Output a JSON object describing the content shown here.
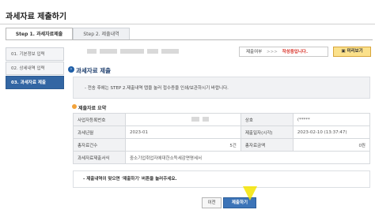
{
  "page": {
    "title": "과세자료 제출하기"
  },
  "tabs": [
    {
      "label": "Step 1. 과세자료제출"
    },
    {
      "label": "Step 2. 제출내역"
    }
  ],
  "steps": [
    {
      "label": "01. 기본정보 입력"
    },
    {
      "label": "02. 상세내역 입력"
    },
    {
      "label": "03. 과세자료 제출"
    }
  ],
  "status": {
    "label": "제출여부",
    "separator": ">>>",
    "value": "작성중입니다.",
    "preview_label": "미리보기"
  },
  "section": {
    "title": "과세자료 제출",
    "notice": "- 전송 후에는 STEP 2.제출내역 탭을 눌러 접수증을 인쇄/보관하시기 바랍니다."
  },
  "summary": {
    "title": "제출자료 요약",
    "rows": [
      {
        "th1": "사업자등록번호",
        "v1": "",
        "th2": "상호",
        "v2": "(*****"
      },
      {
        "th1": "과세년월",
        "v1": "2023-01",
        "th2": "제출일자(시각)",
        "v2": "2023-02-10 (13:37:47)"
      },
      {
        "th1": "총자료건수",
        "v1": "5건",
        "th2": "총자료금액",
        "v2": "0원"
      },
      {
        "th1": "과세자료제출서식",
        "v1": "중소기업취업자에대한소득세감면명세서",
        "th2": "",
        "v2": ""
      }
    ]
  },
  "bottom_notice": "- 제출내역이 맞으면 '제출하기' 버튼을 눌러주세요.",
  "buttons": {
    "prev": "이전",
    "submit": "제출하기"
  },
  "colors": {
    "accent": "#3366a3",
    "highlight_arrow": "#f5e400",
    "status_value": "#d9362c"
  }
}
